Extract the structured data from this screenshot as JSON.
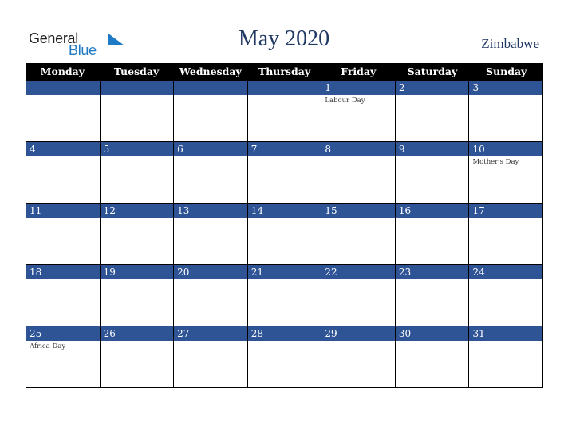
{
  "logo": {
    "word1": "General",
    "word2": "Blue"
  },
  "title": "May 2020",
  "country": "Zimbabwe",
  "colors": {
    "header_bg": "#000000",
    "day_bar": "#2f5496",
    "title": "#1f3864",
    "logo_blue": "#1e7ac4"
  },
  "weekdays": [
    "Monday",
    "Tuesday",
    "Wednesday",
    "Thursday",
    "Friday",
    "Saturday",
    "Sunday"
  ],
  "weeks": [
    [
      {
        "day": "",
        "event": ""
      },
      {
        "day": "",
        "event": ""
      },
      {
        "day": "",
        "event": ""
      },
      {
        "day": "",
        "event": ""
      },
      {
        "day": "1",
        "event": "Labour Day"
      },
      {
        "day": "2",
        "event": ""
      },
      {
        "day": "3",
        "event": ""
      }
    ],
    [
      {
        "day": "4",
        "event": ""
      },
      {
        "day": "5",
        "event": ""
      },
      {
        "day": "6",
        "event": ""
      },
      {
        "day": "7",
        "event": ""
      },
      {
        "day": "8",
        "event": ""
      },
      {
        "day": "9",
        "event": ""
      },
      {
        "day": "10",
        "event": "Mother's Day"
      }
    ],
    [
      {
        "day": "11",
        "event": ""
      },
      {
        "day": "12",
        "event": ""
      },
      {
        "day": "13",
        "event": ""
      },
      {
        "day": "14",
        "event": ""
      },
      {
        "day": "15",
        "event": ""
      },
      {
        "day": "16",
        "event": ""
      },
      {
        "day": "17",
        "event": ""
      }
    ],
    [
      {
        "day": "18",
        "event": ""
      },
      {
        "day": "19",
        "event": ""
      },
      {
        "day": "20",
        "event": ""
      },
      {
        "day": "21",
        "event": ""
      },
      {
        "day": "22",
        "event": ""
      },
      {
        "day": "23",
        "event": ""
      },
      {
        "day": "24",
        "event": ""
      }
    ],
    [
      {
        "day": "25",
        "event": "Africa Day"
      },
      {
        "day": "26",
        "event": ""
      },
      {
        "day": "27",
        "event": ""
      },
      {
        "day": "28",
        "event": ""
      },
      {
        "day": "29",
        "event": ""
      },
      {
        "day": "30",
        "event": ""
      },
      {
        "day": "31",
        "event": ""
      }
    ]
  ]
}
